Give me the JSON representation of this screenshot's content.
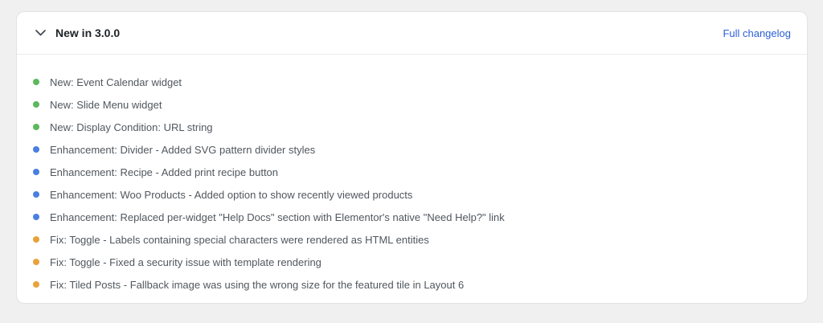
{
  "panel": {
    "title": "New in 3.0.0",
    "changelog_link": "Full changelog"
  },
  "colors": {
    "new": "#5cb85c",
    "enhancement": "#4a7fe0",
    "fix": "#e8a23a"
  },
  "changes": [
    {
      "type": "new",
      "text": "New: Event Calendar widget"
    },
    {
      "type": "new",
      "text": "New: Slide Menu widget"
    },
    {
      "type": "new",
      "text": "New: Display Condition: URL string"
    },
    {
      "type": "enhancement",
      "text": "Enhancement: Divider - Added SVG pattern divider styles"
    },
    {
      "type": "enhancement",
      "text": "Enhancement: Recipe - Added print recipe button"
    },
    {
      "type": "enhancement",
      "text": "Enhancement: Woo Products - Added option to show recently viewed products"
    },
    {
      "type": "enhancement",
      "text": "Enhancement: Replaced per-widget \"Help Docs\" section with Elementor's native \"Need Help?\" link"
    },
    {
      "type": "fix",
      "text": "Fix: Toggle - Labels containing special characters were rendered as HTML entities"
    },
    {
      "type": "fix",
      "text": "Fix: Toggle - Fixed a security issue with template rendering"
    },
    {
      "type": "fix",
      "text": "Fix: Tiled Posts - Fallback image was using the wrong size for the featured tile in Layout 6"
    }
  ]
}
